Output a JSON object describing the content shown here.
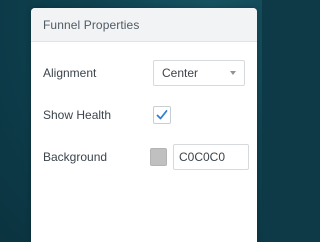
{
  "panel": {
    "title": "Funnel Properties"
  },
  "properties": {
    "alignment": {
      "label": "Alignment",
      "value": "Center"
    },
    "show_health": {
      "label": "Show Health",
      "checked": true
    },
    "background": {
      "label": "Background",
      "value": "C0C0C0",
      "swatch_color": "#C0C0C0"
    }
  },
  "colors": {
    "accent": "#2f7fd6",
    "page_background": "#0d3a46"
  }
}
